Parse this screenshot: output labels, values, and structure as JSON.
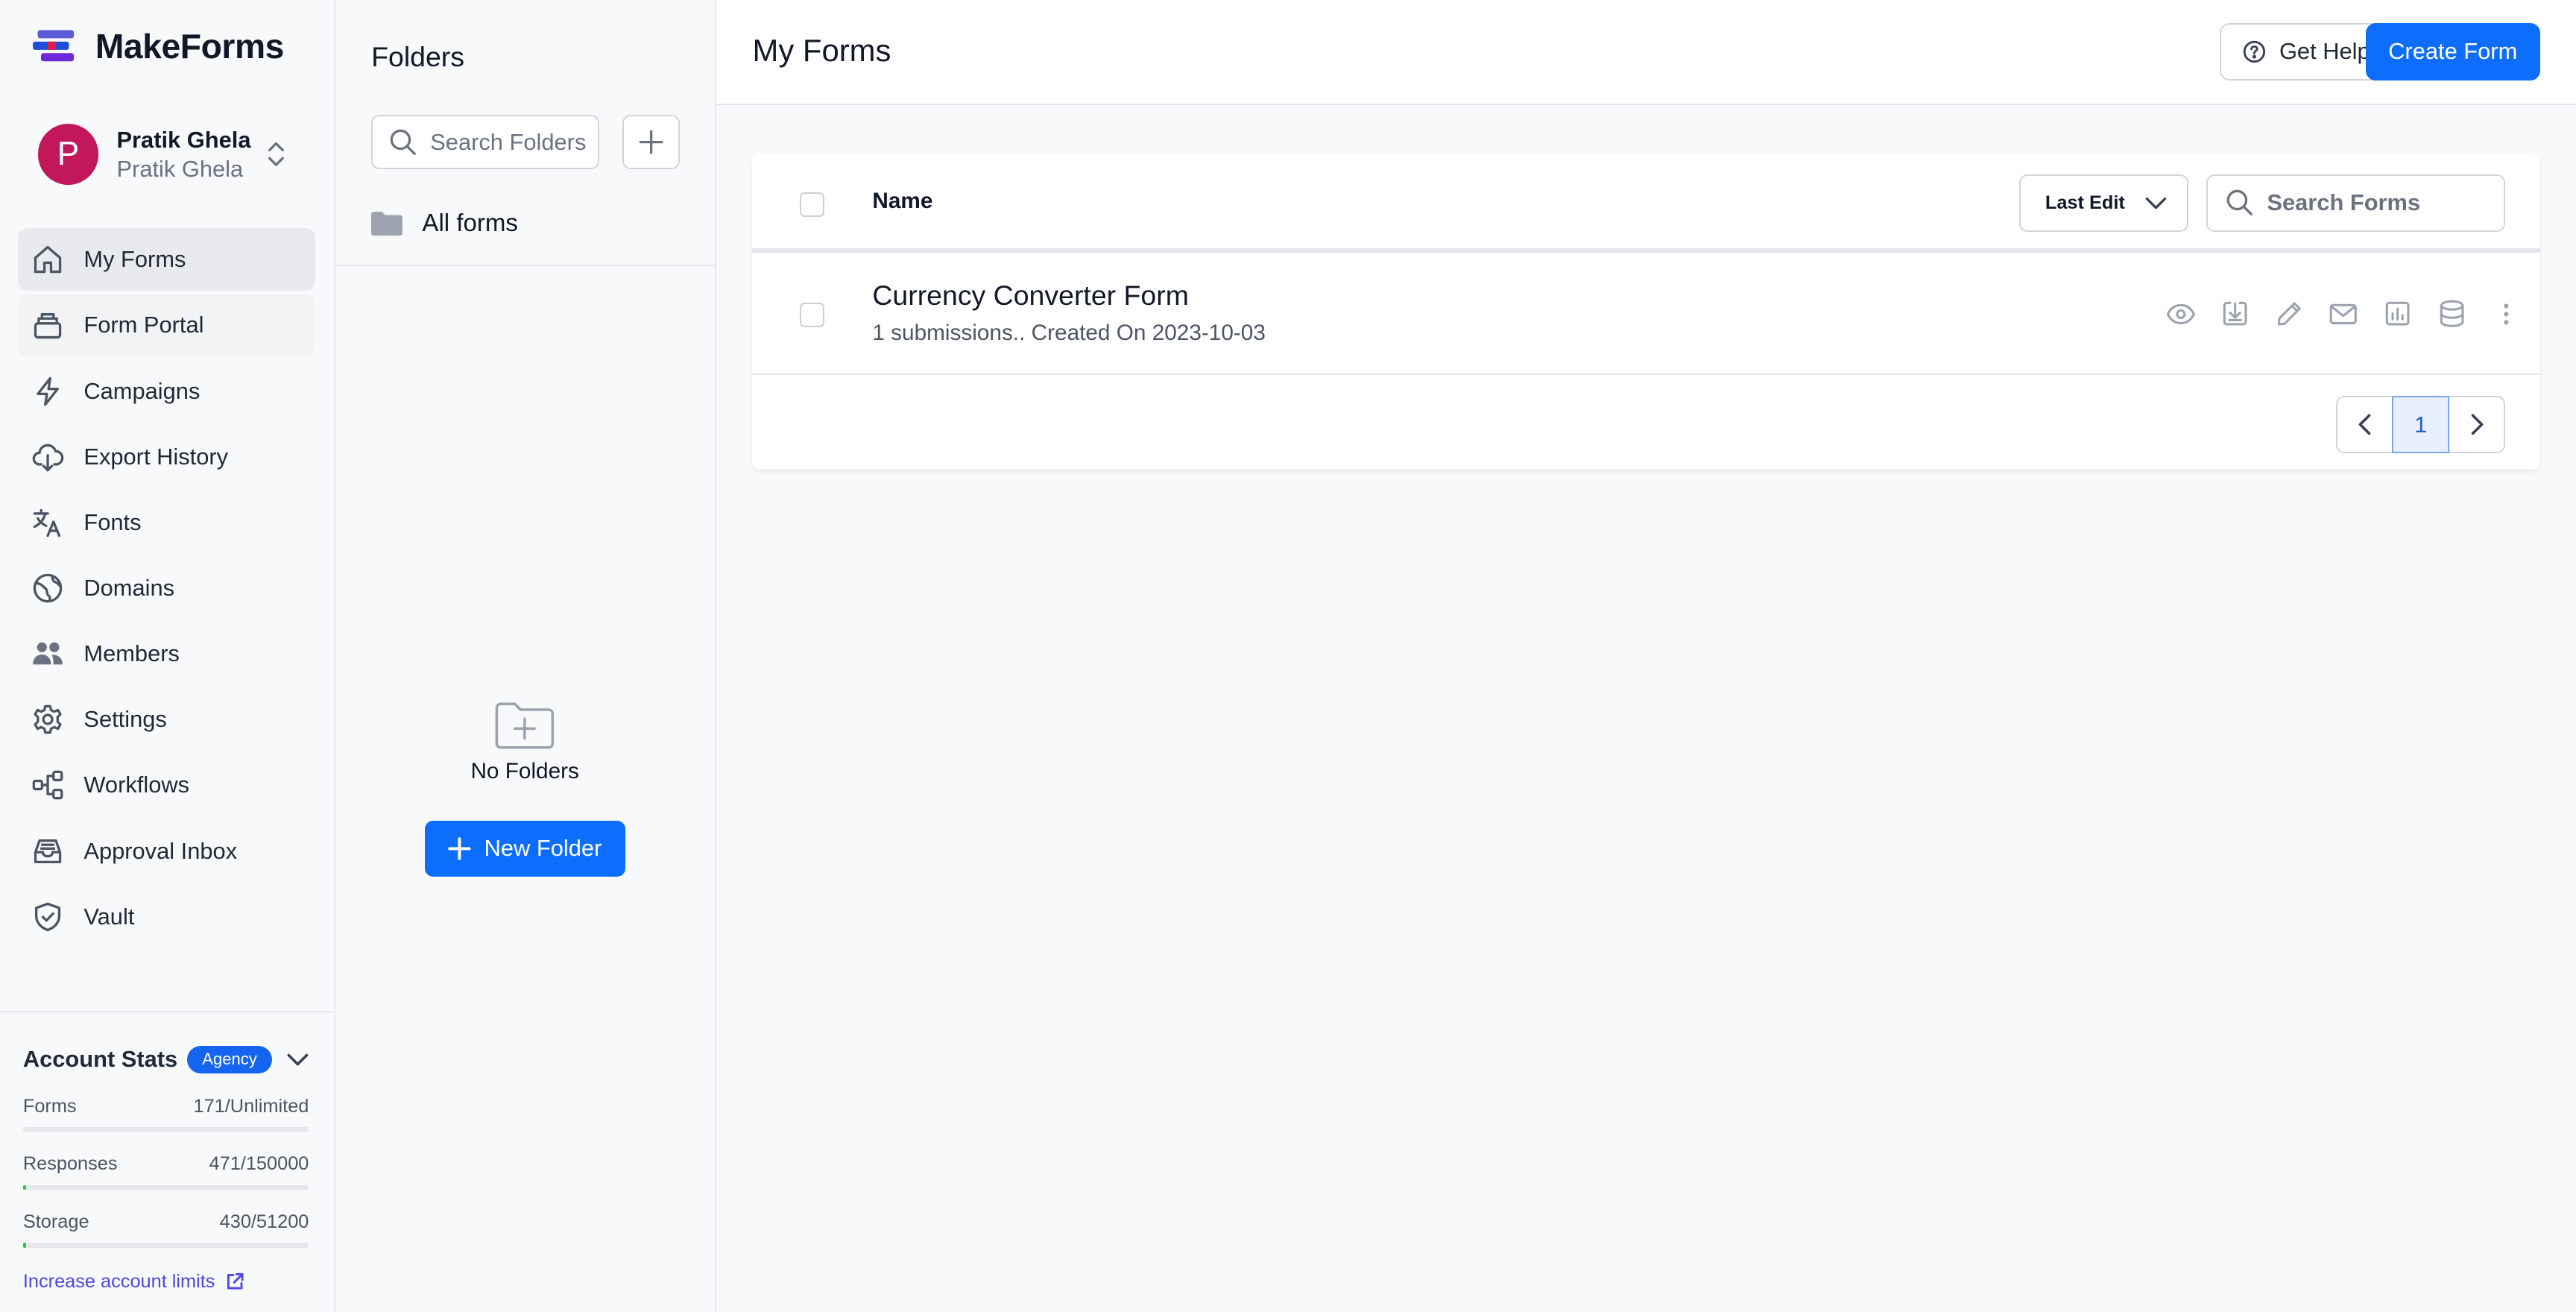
{
  "brand": {
    "name": "MakeForms"
  },
  "user": {
    "name": "Pratik Ghela",
    "subtitle": "Pratik Ghela",
    "initial": "P",
    "avatar_color": "#c2185b"
  },
  "nav": [
    {
      "label": "My Forms",
      "icon": "home-icon",
      "state": "active"
    },
    {
      "label": "Form Portal",
      "icon": "portal-icon",
      "state": "hover"
    },
    {
      "label": "Campaigns",
      "icon": "lightning-icon"
    },
    {
      "label": "Export History",
      "icon": "cloud-download-icon"
    },
    {
      "label": "Fonts",
      "icon": "translate-icon"
    },
    {
      "label": "Domains",
      "icon": "globe-icon"
    },
    {
      "label": "Members",
      "icon": "users-icon"
    },
    {
      "label": "Settings",
      "icon": "gear-icon"
    },
    {
      "label": "Workflows",
      "icon": "workflow-icon"
    },
    {
      "label": "Approval Inbox",
      "icon": "inbox-icon"
    },
    {
      "label": "Vault",
      "icon": "shield-check-icon"
    }
  ],
  "stats": {
    "title": "Account Stats",
    "badge": "Agency",
    "rows": [
      {
        "label": "Forms",
        "value": "171/Unlimited",
        "fraction": 0
      },
      {
        "label": "Responses",
        "value": "471/150000",
        "fraction": 0.0031
      },
      {
        "label": "Storage",
        "value": "430/51200",
        "fraction": 0.0084
      }
    ],
    "limits_link": "Increase account limits"
  },
  "folders": {
    "title": "Folders",
    "search_placeholder": "Search Folders",
    "all_forms": "All forms",
    "empty_text": "No Folders",
    "new_folder_label": "New Folder"
  },
  "header": {
    "title": "My Forms",
    "help_label": "Get Help",
    "create_label": "Create Form"
  },
  "table": {
    "name_header": "Name",
    "sort_label": "Last Edit",
    "search_placeholder": "Search Forms",
    "rows": [
      {
        "name": "Currency Converter Form",
        "meta": "1 submissions.. Created On 2023-10-03"
      }
    ],
    "row_actions": [
      "eye-icon",
      "download-icon",
      "pencil-icon",
      "mail-icon",
      "chart-icon",
      "database-icon",
      "more-vertical-icon"
    ]
  },
  "pagination": {
    "current": "1"
  },
  "colors": {
    "primary": "#0d6efd",
    "brand_purple": "#4f46e5",
    "progress": "#22c55e"
  }
}
